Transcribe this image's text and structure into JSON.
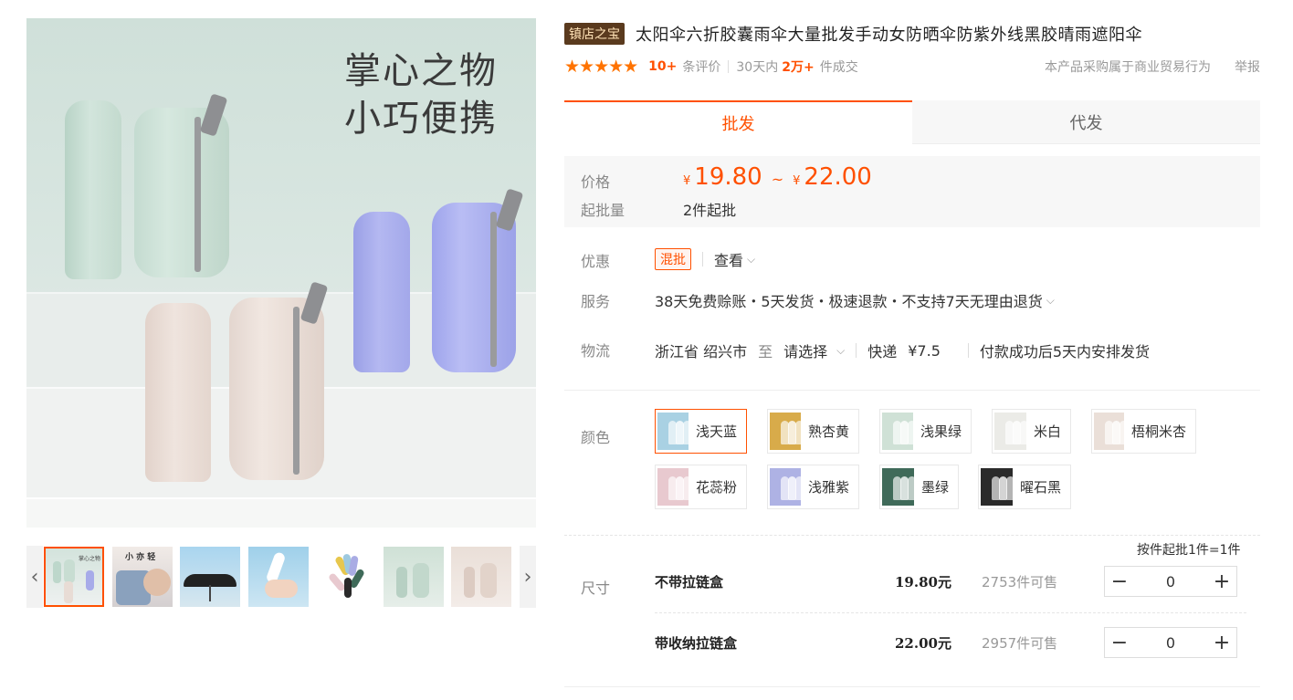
{
  "gallery": {
    "slogan_line1": "掌心之物",
    "slogan_line2": "小巧便携",
    "prev_icon": "chevron-left-icon",
    "next_icon": "chevron-right-icon",
    "thumb_count": 7
  },
  "product": {
    "badge": "镇店之宝",
    "title": "太阳伞六折胶囊雨伞大量批发手动女防晒伞防紫外线黑胶晴雨遮阳伞",
    "rating_stars": 5,
    "reviews_count": "10+",
    "reviews_label": "条评价",
    "sales_prefix": "30天内",
    "sales_count": "2万+",
    "sales_suffix": "件成交",
    "trade_note": "本产品采购属于商业贸易行为",
    "report_label": "举报"
  },
  "tabs": [
    {
      "label": "批发",
      "active": true
    },
    {
      "label": "代发",
      "active": false
    }
  ],
  "price": {
    "label": "价格",
    "currency": "¥",
    "min": "19.80",
    "tilde": "~",
    "max": "22.00",
    "moq_label": "起批量",
    "moq_value": "2件起批"
  },
  "promo": {
    "label": "优惠",
    "tag": "混批",
    "view": "查看"
  },
  "service": {
    "label": "服务",
    "text": "38天免费赊账・5天发货・极速退款・不支持7天无理由退货"
  },
  "logistics": {
    "label": "物流",
    "origin": "浙江省 绍兴市",
    "to": "至",
    "select": "请选择",
    "express": "快递",
    "fee": "¥7.5",
    "ship_note": "付款成功后5天内安排发货"
  },
  "colors": {
    "label": "颜色",
    "options": [
      {
        "label": "浅天蓝",
        "color": "#a9d1e3",
        "selected": true
      },
      {
        "label": "熟杏黄",
        "color": "#d8ab4a",
        "selected": false
      },
      {
        "label": "浅果绿",
        "color": "#cfe1d6",
        "selected": false
      },
      {
        "label": "米白",
        "color": "#ebebe7",
        "selected": false
      },
      {
        "label": "梧桐米杏",
        "color": "#eadfd8",
        "selected": false
      },
      {
        "label": "花蕊粉",
        "color": "#e8c9cf",
        "selected": false
      },
      {
        "label": "浅雅紫",
        "color": "#aeb2e4",
        "selected": false
      },
      {
        "label": "墨绿",
        "color": "#3f6a59",
        "selected": false
      },
      {
        "label": "曜石黑",
        "color": "#2a2a2a",
        "selected": false
      }
    ]
  },
  "sizes": {
    "label": "尺寸",
    "rule": "按件起批1件=1件",
    "rows": [
      {
        "name": "不带拉链盒",
        "price": "19.80元",
        "stock": "2753件可售",
        "qty": "0"
      },
      {
        "name": "带收纳拉链盒",
        "price": "22.00元",
        "stock": "2957件可售",
        "qty": "0"
      }
    ],
    "minus": "−",
    "plus": "+"
  }
}
